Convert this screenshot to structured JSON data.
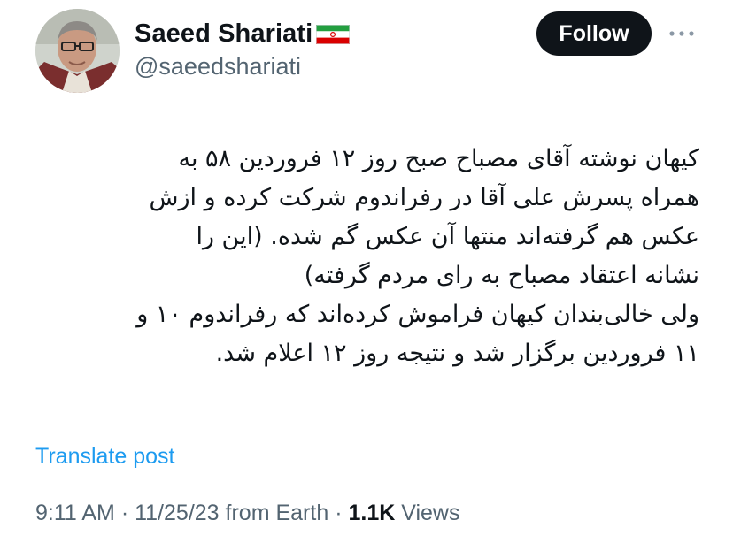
{
  "author": {
    "display_name": "Saeed Shariati",
    "handle": "@saeedshariati",
    "flag": "iran-flag-icon"
  },
  "header": {
    "follow_label": "Follow",
    "more_icon": "more-dots-icon"
  },
  "tweet": {
    "lines": [
      "کیهان نوشته آقای مصباح صبح روز ۱۲ فروردین ۵۸ به",
      "همراه پسرش علی آقا در رفراندوم شرکت کرده و ازش",
      "عکس هم گرفته‌اند منتها آن عکس گم شده.  (این را",
      "نشانه اعتقاد مصباح به رای مردم گرفته)",
      "ولی خالی‌بندان کیهان فراموش کرده‌اند که رفراندوم ۱۰ و",
      "۱۱ فروردین برگزار شد و نتیجه روز ۱۲ اعلام شد."
    ]
  },
  "translate_label": "Translate post",
  "meta": {
    "time": "9:11 AM",
    "date": "11/25/23",
    "source": "from Earth",
    "views_count": "1.1K",
    "views_label": "Views",
    "separator": "·"
  },
  "colors": {
    "text_primary": "#0f1419",
    "text_secondary": "#536471",
    "link": "#1d9bf0",
    "button_bg": "#0f1419"
  }
}
